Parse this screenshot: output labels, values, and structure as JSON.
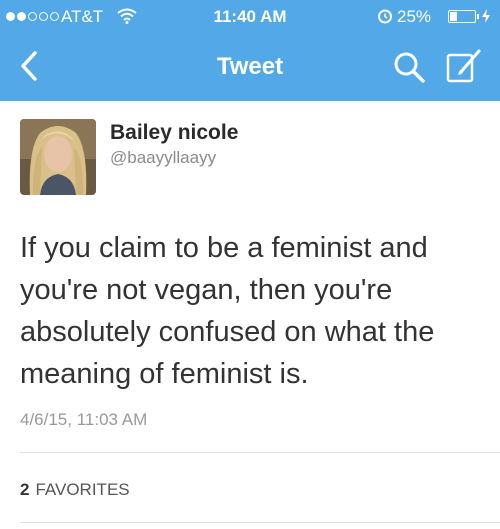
{
  "status_bar": {
    "carrier": "AT&T",
    "time": "11:40 AM",
    "battery_percent": "25%",
    "battery_level": 0.25,
    "signal_bars_filled": 2,
    "signal_bars_total": 5
  },
  "nav": {
    "title": "Tweet",
    "back_icon": "chevron-left-icon",
    "search_icon": "search-icon",
    "compose_icon": "compose-icon"
  },
  "tweet": {
    "author_name": "Bailey nicole",
    "author_handle": "@baayyllaayy",
    "text": "If you claim to be a feminist and you're not vegan, then you're absolutely confused on what the meaning of feminist is.",
    "timestamp": "4/6/15, 11:03 AM",
    "favorites_count": "2",
    "favorites_label": "FAVORITES"
  },
  "colors": {
    "header_blue": "#53a9e8",
    "white": "#ffffff"
  }
}
